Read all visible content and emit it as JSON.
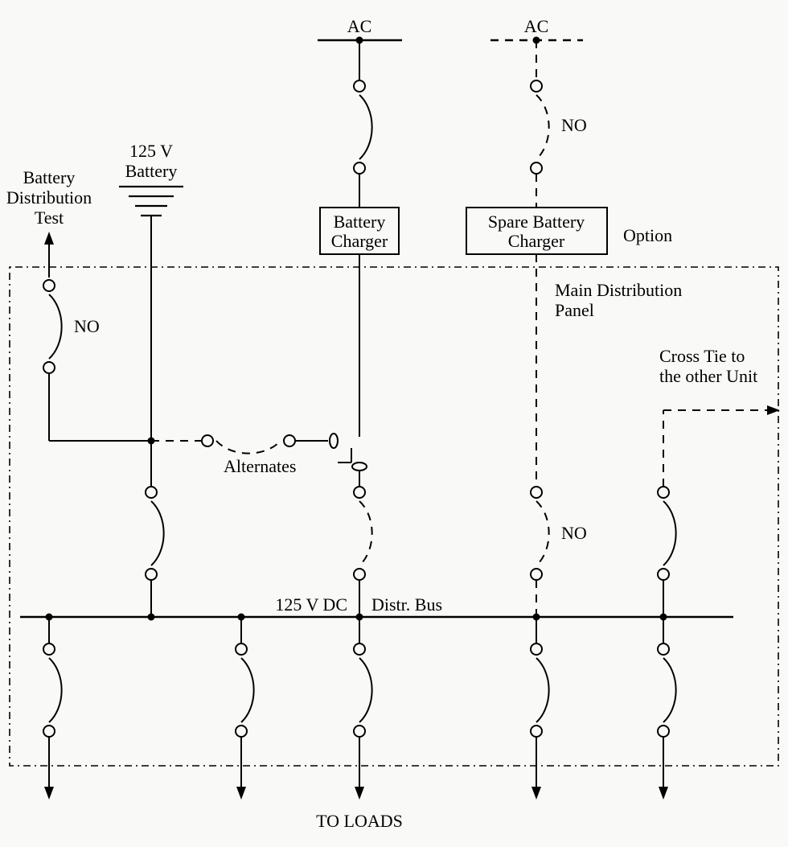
{
  "labels": {
    "ac1": "AC",
    "ac2": "AC",
    "battery_voltage": "125 V",
    "battery_name": "Battery",
    "distribution_test_l1": "Battery",
    "distribution_test_l2": "Distribution",
    "distribution_test_l3": "Test",
    "charger_l1": "Battery",
    "charger_l2": "Charger",
    "spare_l1": "Spare Battery",
    "spare_l2": "Charger",
    "option": "Option",
    "panel_l1": "Main Distribution",
    "panel_l2": "Panel",
    "crosstie_l1": "Cross Tie to",
    "crosstie_l2": "the other Unit",
    "alternates": "Alternates",
    "bus_left": "125 V DC",
    "bus_right": "Distr. Bus",
    "to_loads": "TO LOADS",
    "no1": "NO",
    "no2": "NO",
    "no3": "NO"
  }
}
